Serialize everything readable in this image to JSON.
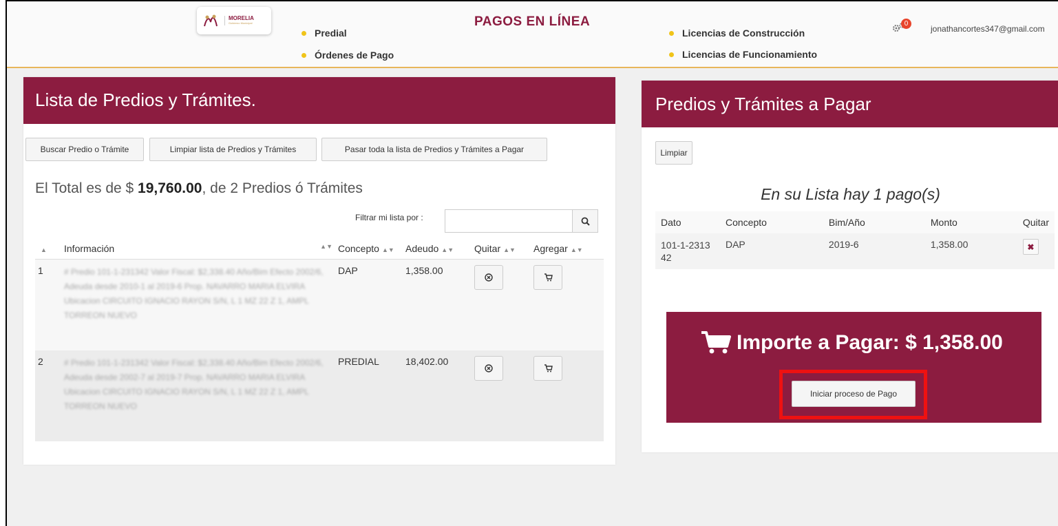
{
  "header": {
    "logo_text": "MORELIA",
    "logo_subtext": "Gobierno Municipal",
    "site_title": "PAGOS EN LÍNEA",
    "nav": {
      "predial": "Predial",
      "ordenes": "Órdenes de Pago",
      "construccion": "Licencias de Construcción",
      "funcionamiento": "Licencias de Funcionamiento"
    },
    "notifications": "0",
    "user_email": "jonathancortes347@gmail.com"
  },
  "left": {
    "title": "Lista de Predios y Trámites.",
    "buttons": {
      "buscar": "Buscar Predio o Trámite",
      "limpiar_lista": "Limpiar lista de Predios y Trámites",
      "pasar_todo": "Pasar toda la lista de Predios y Trámites a Pagar"
    },
    "total_prefix": "El Total es de $ ",
    "total_amount": "19,760.00",
    "total_suffix": ", de 2 Predios ó Trámites",
    "filter_label": "Filtrar mi lista por :",
    "filter_value": "",
    "columns": {
      "informacion": "Información",
      "concepto": "Concepto",
      "adeudo": "Adeudo",
      "quitar": "Quitar",
      "agregar": "Agregar"
    },
    "rows": [
      {
        "num": "1",
        "info": "# Predio 101-1-231342 Valor Fiscal: $2,338.40 Año/Bim Efecto 2002/6, Adeuda desde 2010-1 al 2019-6 Prop. NAVARRO MARIA ELVIRA Ubicacion CIRCUITO IGNACIO RAYON S/N, L 1 MZ 22 Z 1, AMPL TORREON NUEVO",
        "concepto": "DAP",
        "adeudo": "1,358.00"
      },
      {
        "num": "2",
        "info": "# Predio 101-1-231342 Valor Fiscal: $2,338.40 Año/Bim Efecto 2002/6, Adeuda desde 2002-7 al 2019-7 Prop. NAVARRO MARIA ELVIRA Ubicacion CIRCUITO IGNACIO RAYON S/N, L 1 MZ 22 Z 1, AMPL TORREON NUEVO",
        "concepto": "PREDIAL",
        "adeudo": "18,402.00"
      }
    ]
  },
  "right": {
    "title": "Predios y Trámites a Pagar",
    "limpiar": "Limpiar",
    "count_text": "En su Lista hay 1 pago(s)",
    "columns": {
      "dato": "Dato",
      "concepto": "Concepto",
      "bim": "Bim/Año",
      "monto": "Monto",
      "quitar": "Quitar"
    },
    "rows": [
      {
        "dato": "101-1-231342",
        "concepto": "DAP",
        "bim": "2019-6",
        "monto": "1,358.00"
      }
    ],
    "importe_label": "Importe a Pagar: $ 1,358.00",
    "pay_button": "Iniciar proceso de Pago"
  },
  "colors": {
    "brand": "#8c1c40",
    "accent": "#f0c419",
    "highlight": "#ee1111"
  }
}
